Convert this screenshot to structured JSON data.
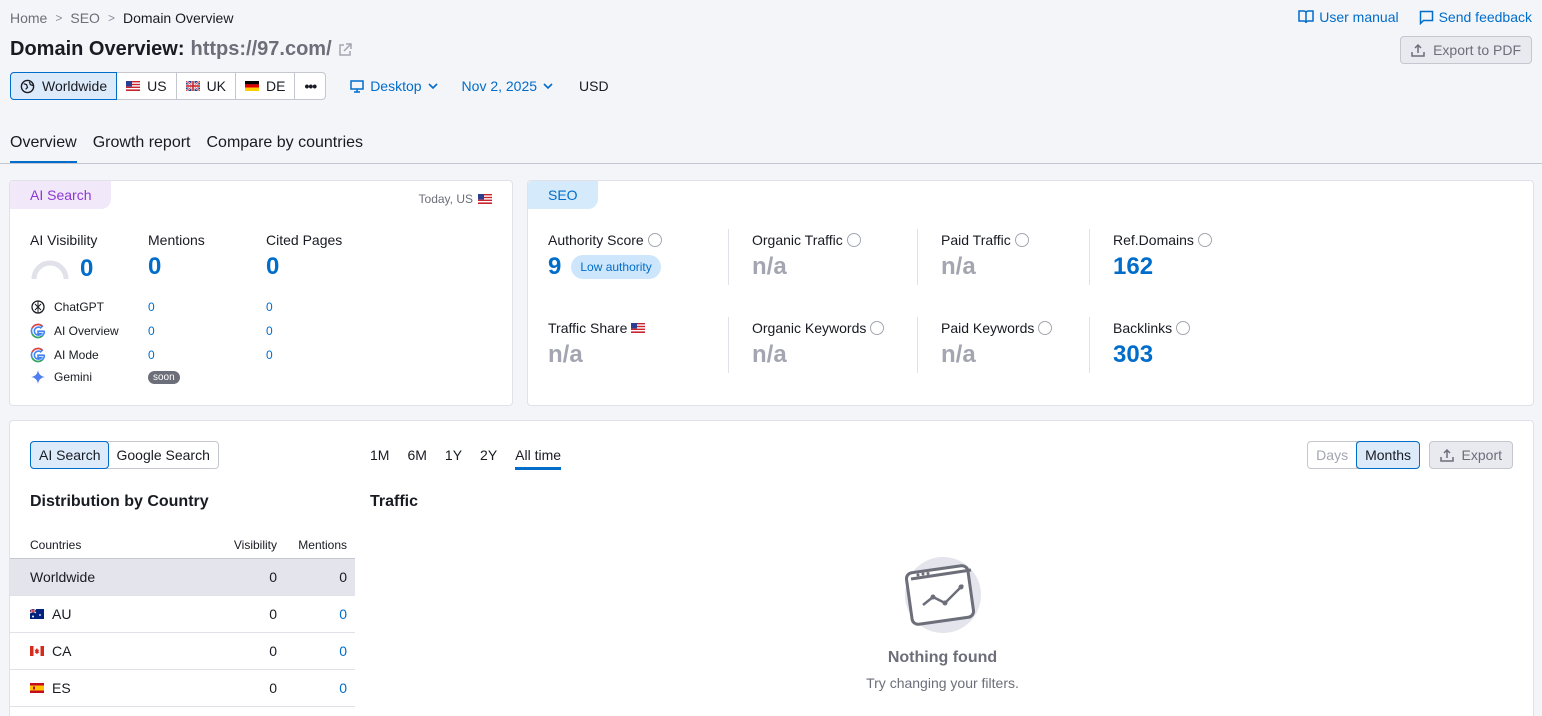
{
  "breadcrumb": {
    "home": "Home",
    "seo": "SEO",
    "current": "Domain Overview"
  },
  "toplinks": {
    "manual": "User manual",
    "feedback": "Send feedback"
  },
  "title": {
    "prefix": "Domain Overview:",
    "url": "https://97.com/"
  },
  "export_pdf": "Export to PDF",
  "databases": {
    "worldwide": "Worldwide",
    "us": "US",
    "uk": "UK",
    "de": "DE",
    "more": "•••"
  },
  "device": "Desktop",
  "date": "Nov 2, 2025",
  "currency": "USD",
  "tabs": [
    "Overview",
    "Growth report",
    "Compare by countries"
  ],
  "ai_card": {
    "badge": "AI Search",
    "date_note": "Today, US",
    "visibility_label": "AI Visibility",
    "visibility_value": "0",
    "mentions_label": "Mentions",
    "mentions_value": "0",
    "cited_label": "Cited Pages",
    "cited_value": "0",
    "rows": [
      {
        "name": "ChatGPT",
        "mentions": "0",
        "cited": "0"
      },
      {
        "name": "AI Overview",
        "mentions": "0",
        "cited": "0"
      },
      {
        "name": "AI Mode",
        "mentions": "0",
        "cited": "0"
      },
      {
        "name": "Gemini",
        "soon": "soon"
      }
    ]
  },
  "seo_card": {
    "badge": "SEO",
    "authority_label": "Authority Score",
    "authority_value": "9",
    "authority_badge": "Low authority",
    "organic_traffic_label": "Organic Traffic",
    "organic_traffic_value": "n/a",
    "paid_traffic_label": "Paid Traffic",
    "paid_traffic_value": "n/a",
    "ref_domains_label": "Ref.Domains",
    "ref_domains_value": "162",
    "traffic_share_label": "Traffic Share",
    "traffic_share_value": "n/a",
    "organic_keywords_label": "Organic Keywords",
    "organic_keywords_value": "n/a",
    "paid_keywords_label": "Paid Keywords",
    "paid_keywords_value": "n/a",
    "backlinks_label": "Backlinks",
    "backlinks_value": "303"
  },
  "bottom": {
    "toggle": {
      "ai": "AI Search",
      "google": "Google Search"
    },
    "ranges": [
      "1M",
      "6M",
      "1Y",
      "2Y",
      "All time"
    ],
    "days": "Days",
    "months": "Months",
    "export": "Export",
    "dist_title": "Distribution by Country",
    "traffic_title": "Traffic",
    "table": {
      "headers": {
        "country": "Countries",
        "visibility": "Visibility",
        "mentions": "Mentions"
      },
      "rows": [
        {
          "country": "Worldwide",
          "visibility": "0",
          "mentions": "0"
        },
        {
          "country": "AU",
          "visibility": "0",
          "mentions": "0"
        },
        {
          "country": "CA",
          "visibility": "0",
          "mentions": "0"
        },
        {
          "country": "ES",
          "visibility": "0",
          "mentions": "0"
        }
      ]
    },
    "empty_title": "Nothing found",
    "empty_sub": "Try changing your filters."
  },
  "colors": {
    "accent": "#006dca",
    "ai": "#8d39d1",
    "muted": "#a3a6b1"
  }
}
